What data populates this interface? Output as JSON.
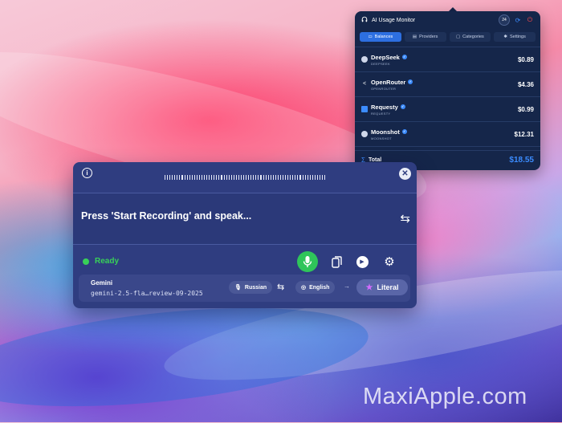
{
  "monitor": {
    "title": "AI Usage Monitor",
    "badge": "24",
    "tabs": [
      {
        "label": "Balances",
        "icon": "wallet-icon",
        "active": true
      },
      {
        "label": "Providers",
        "icon": "server-icon",
        "active": false
      },
      {
        "label": "Categories",
        "icon": "folder-icon",
        "active": false
      },
      {
        "label": "Settings",
        "icon": "gear-icon",
        "active": false
      }
    ],
    "providers": [
      {
        "name": "DeepSeek",
        "sub": "DEEPSEEK",
        "amount": "$0.89"
      },
      {
        "name": "OpenRouter",
        "sub": "OPENROUTER",
        "amount": "$4.36"
      },
      {
        "name": "Requesty",
        "sub": "REQUESTY",
        "amount": "$0.99"
      },
      {
        "name": "Moonshot",
        "sub": "MOONSHOT",
        "amount": "$12.31"
      }
    ],
    "total_label": "Total",
    "total_amount": "$18.55"
  },
  "dictation": {
    "transcript": "Press 'Start Recording' and speak...",
    "status": "Ready",
    "model_provider": "Gemini",
    "model_name": "gemini-2.5-fla…review-09-2025",
    "source_lang": "Russian",
    "target_lang": "English",
    "mode": "Literal"
  },
  "watermark": "MaxiApple.com",
  "colors": {
    "accent_blue": "#2d6fe0",
    "ready_green": "#38d158",
    "panel_bg": "#2f3d80",
    "monitor_bg": "#15264a",
    "total_blue": "#3b8cff"
  }
}
